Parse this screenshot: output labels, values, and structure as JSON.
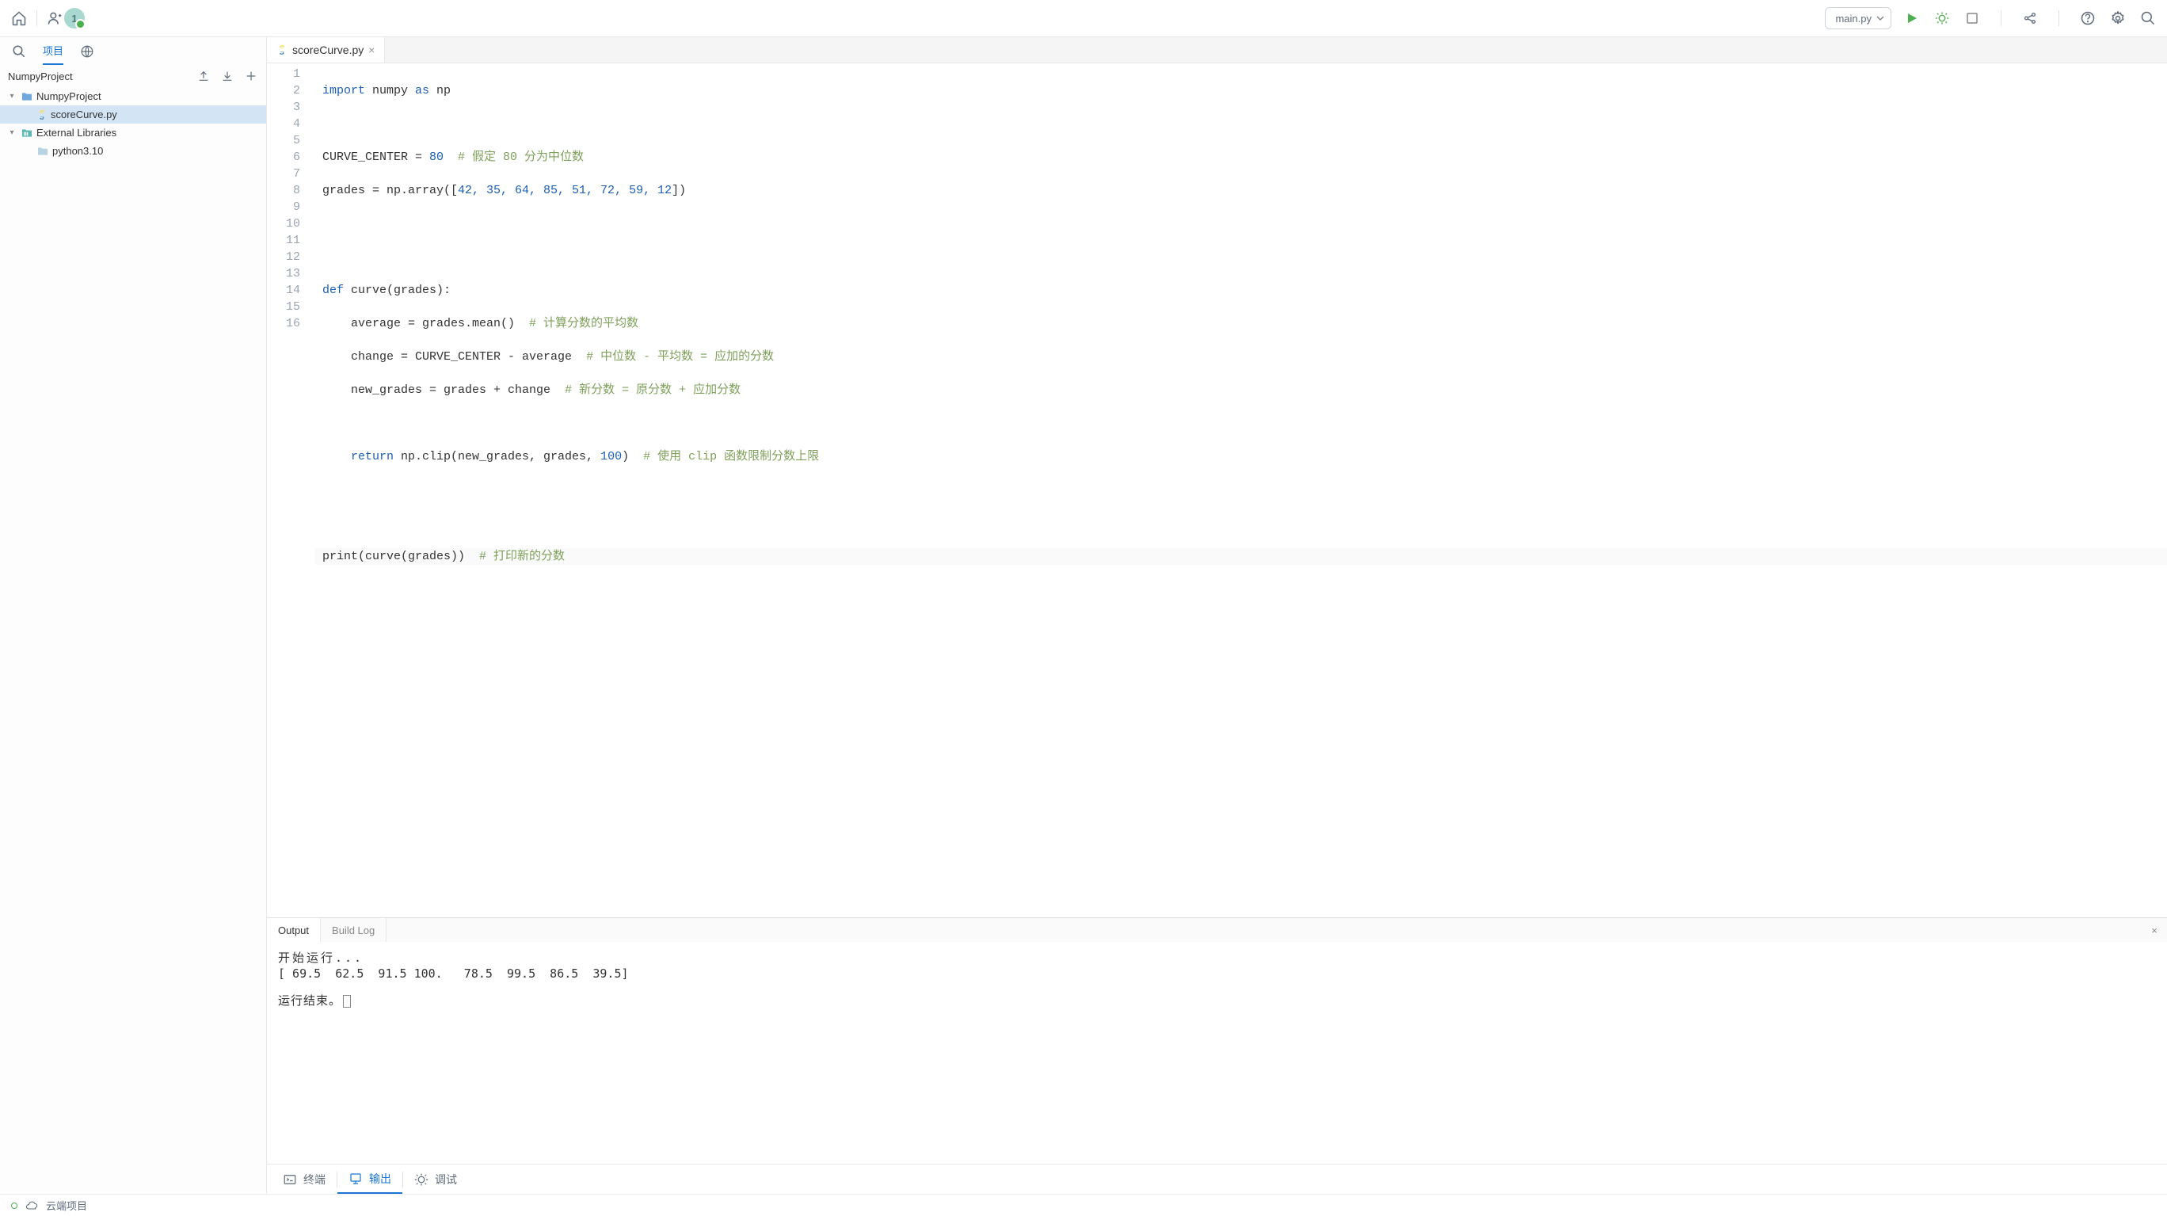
{
  "toolbar": {
    "avatar_initial": "1",
    "run_config": "main.py"
  },
  "sidebar": {
    "tab_project": "项目",
    "breadcrumb": "NumpyProject",
    "tree": [
      {
        "name": "NumpyProject",
        "expanded": true
      },
      {
        "name": "scoreCurve.py",
        "selected": true
      },
      {
        "name": "External Libraries",
        "expanded": true
      },
      {
        "name": "python3.10"
      }
    ]
  },
  "editor": {
    "tab_name": "scoreCurve.py",
    "lines": [
      "1",
      "2",
      "3",
      "4",
      "5",
      "6",
      "7",
      "8",
      "9",
      "10",
      "11",
      "12",
      "13",
      "14",
      "15",
      "16"
    ],
    "code": {
      "l1_import": "import",
      "l1_numpy": " numpy ",
      "l1_as": "as",
      "l1_np": " np",
      "l3_a": "CURVE_CENTER = ",
      "l3_num": "80",
      "l3_c": "  # 假定 80 分为中位数",
      "l4_a": "grades = np.array([",
      "l4_nums": "42, 35, 64, 85, 51, 72, 59, 12",
      "l4_b": "])",
      "l7_def": "def",
      "l7_sig": " curve(grades):",
      "l8_a": "    average = grades.mean()  ",
      "l8_c": "# 计算分数的平均数",
      "l9_a": "    change = CURVE_CENTER - average  ",
      "l9_c": "# 中位数 - 平均数 = 应加的分数",
      "l10_a": "    new_grades = grades + change  ",
      "l10_c": "# 新分数 = 原分数 + 应加分数",
      "l12_ret": "    return",
      "l12_a": " np.clip(new_grades, grades, ",
      "l12_num": "100",
      "l12_b": ")  ",
      "l12_c": "# 使用 clip 函数限制分数上限",
      "l15_a": "print(curve(grades))  ",
      "l15_c": "# 打印新的分数"
    }
  },
  "output": {
    "tab_output": "Output",
    "tab_build": "Build Log",
    "line_start": "开始运行...",
    "line_result": "[ 69.5  62.5  91.5 100.   78.5  99.5  86.5  39.5]",
    "line_end": "运行结束。"
  },
  "bottom": {
    "terminal": "终端",
    "output": "输出",
    "debug": "调试"
  },
  "status": {
    "cloud": "云端项目"
  }
}
